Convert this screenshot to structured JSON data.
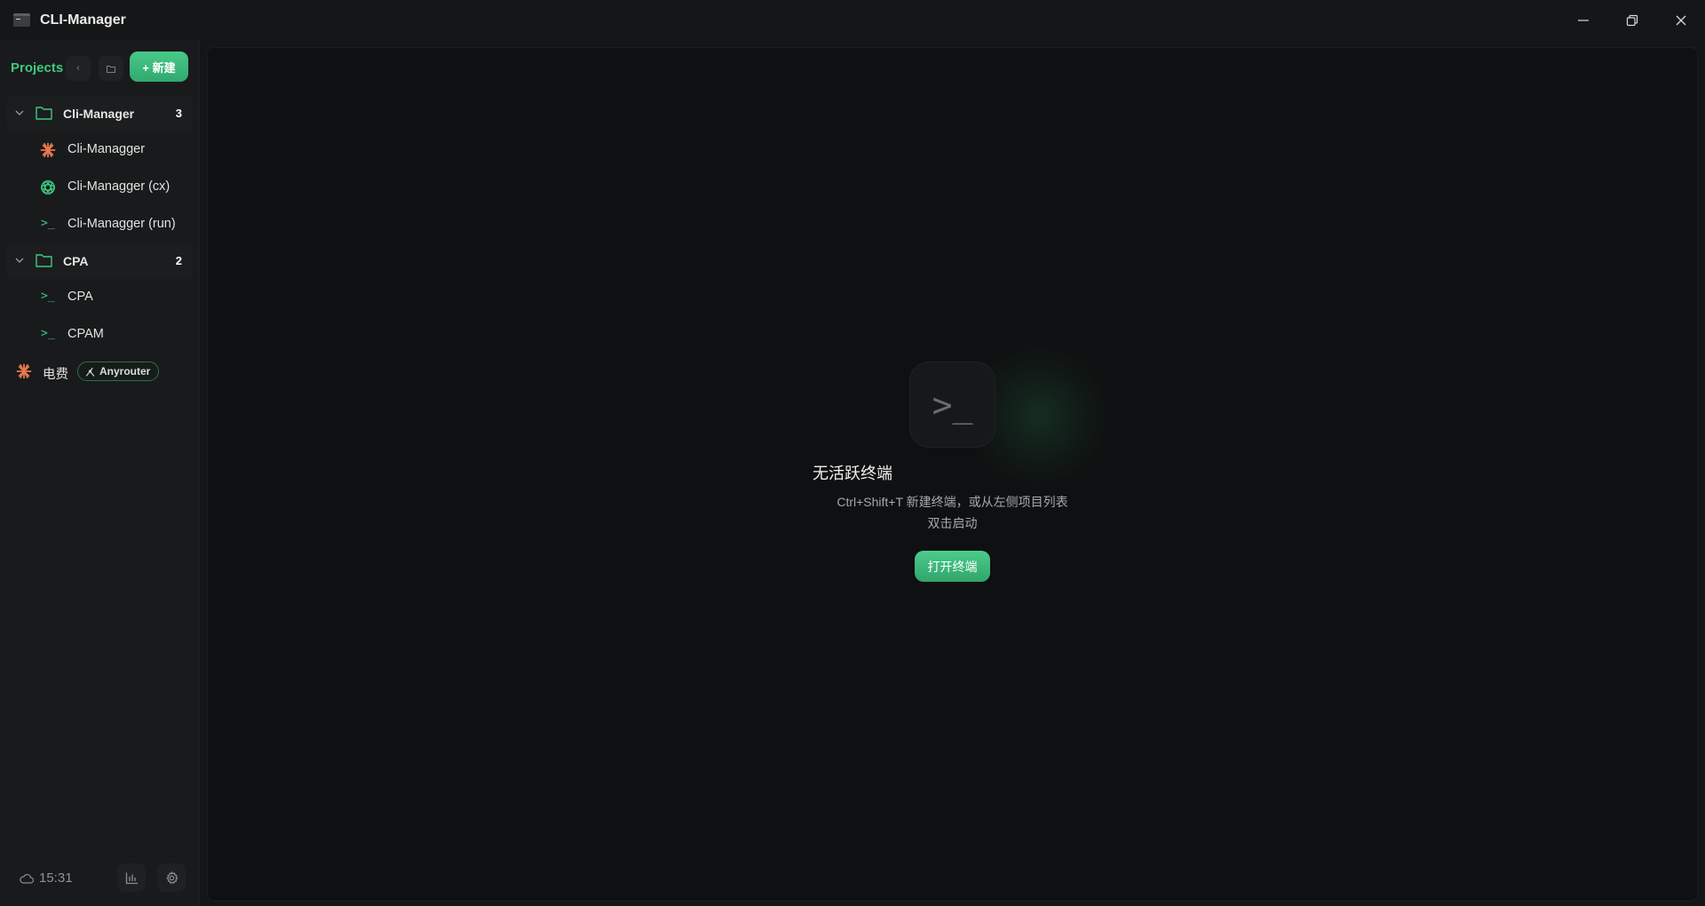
{
  "window": {
    "title": "CLI-Manager",
    "controls": [
      "minimize-icon",
      "restore-icon",
      "close-icon"
    ]
  },
  "sidebar": {
    "header": {
      "title": "Projects",
      "back_icon": "‹",
      "new_label": "+ 新建"
    },
    "groups": [
      {
        "name": "Cli-Manager",
        "count": "3",
        "items": [
          {
            "name": "Cli-Managger",
            "icon": "claude-star-icon"
          },
          {
            "name": "Cli-Managger (cx)",
            "icon": "openai-icon"
          },
          {
            "name": "Cli-Managger (run)",
            "icon": "terminal-icon"
          }
        ]
      },
      {
        "name": "CPA",
        "count": "2",
        "items": [
          {
            "name": "CPA",
            "icon": "terminal-icon"
          },
          {
            "name": "CPAM",
            "icon": "terminal-icon"
          }
        ]
      }
    ],
    "loose_items": [
      {
        "name": "电费",
        "icon": "claude-star-icon",
        "badge": "Anyrouter"
      }
    ],
    "footer": {
      "time": "15:31"
    }
  },
  "main": {
    "empty_icon": ">_",
    "empty_title": "无活跃终端",
    "empty_desc_line1": "Ctrl+Shift+T 新建终端，或从左侧项目列表",
    "empty_desc_line2": "双击启动",
    "open_button": "打开终端"
  },
  "colors": {
    "accent": "#3ec97f",
    "claude_orange": "#e8794f",
    "background": "#0f1011",
    "sidebar": "#191a1b"
  }
}
